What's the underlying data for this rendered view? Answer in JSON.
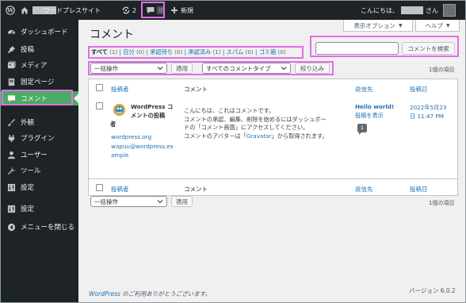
{
  "admin_bar": {
    "site_name": "ワードプレスサイト",
    "updates_count": "2",
    "comments_count": "0",
    "new_label": "新規",
    "greeting_prefix": "こんにちは、",
    "greeting_suffix": "さん"
  },
  "sidebar": {
    "items": [
      {
        "label": "ダッシュボード",
        "icon": "dashboard-icon"
      },
      {
        "label": "投稿",
        "icon": "pin-icon"
      },
      {
        "label": "メディア",
        "icon": "media-icon"
      },
      {
        "label": "固定ページ",
        "icon": "page-icon"
      },
      {
        "label": "コメント",
        "icon": "comment-icon",
        "current": true
      },
      {
        "label": "外観",
        "icon": "brush-icon"
      },
      {
        "label": "プラグイン",
        "icon": "plugin-icon"
      },
      {
        "label": "ユーザー",
        "icon": "user-icon"
      },
      {
        "label": "ツール",
        "icon": "wrench-icon"
      },
      {
        "label": "設定",
        "icon": "settings-icon"
      },
      {
        "label": "設定",
        "icon": "settings-icon"
      },
      {
        "label": "メニューを閉じる",
        "icon": "collapse-icon"
      }
    ]
  },
  "header": {
    "screen_options": "表示オプション",
    "help": "ヘルプ",
    "title": "コメント"
  },
  "status_links": [
    {
      "label": "すべて",
      "count": "(1)",
      "current": true
    },
    {
      "label": "自分",
      "count": "(0)"
    },
    {
      "label": "承認待ち",
      "count": "(0)"
    },
    {
      "label": "承認済み",
      "count": "(1)"
    },
    {
      "label": "スパム",
      "count": "(0)"
    },
    {
      "label": "ゴミ箱",
      "count": "(0)"
    }
  ],
  "search": {
    "placeholder": "",
    "button": "コメントを検索"
  },
  "filters": {
    "bulk_action": "一括操作",
    "apply": "適用",
    "comment_type": "すべてのコメントタイプ",
    "filter": "絞り込み",
    "items_count": "1個の項目"
  },
  "table": {
    "headers": {
      "author": "投稿者",
      "comment": "コメント",
      "response": "返信先",
      "date": "投稿日"
    },
    "rows": [
      {
        "author_name": "WordPress コメントの投稿者",
        "author_line1": "WordPress コ",
        "author_line2": "メントの投稿",
        "author_line3": "者",
        "author_url": "wordpress.org",
        "author_email_1": "wapuu@wordpress.ex",
        "author_email_2": "ample",
        "comment_line1": "こんにちは、これはコメントです。",
        "comment_line2": "コメントの承認、編集、削除を始めるにはダッシュボー",
        "comment_line3": "ドの「コメント画面」にアクセスしてください。",
        "comment_line4_prefix": "コメントのアバターは「",
        "comment_line4_link": "Gravatar",
        "comment_line4_suffix": "」から取得されます。",
        "response_title": "Hello world!",
        "response_view": "投稿を表示",
        "response_count": "1",
        "date_line1": "2022年5月23",
        "date_line2": "日 11:47 PM"
      }
    ]
  },
  "bottom_filters": {
    "bulk_action": "一括操作",
    "apply": "適用",
    "items_count": "1個の項目"
  },
  "footer": {
    "link": "WordPress",
    "text": " のご利用ありがとうございます。",
    "version": "バージョン 6.0.2"
  },
  "colors": {
    "admin_bar": "#1d2327",
    "sidebar": "#1d2327",
    "current_menu": "#4aab62",
    "link": "#2271b1",
    "highlight": "#e26ee4"
  }
}
